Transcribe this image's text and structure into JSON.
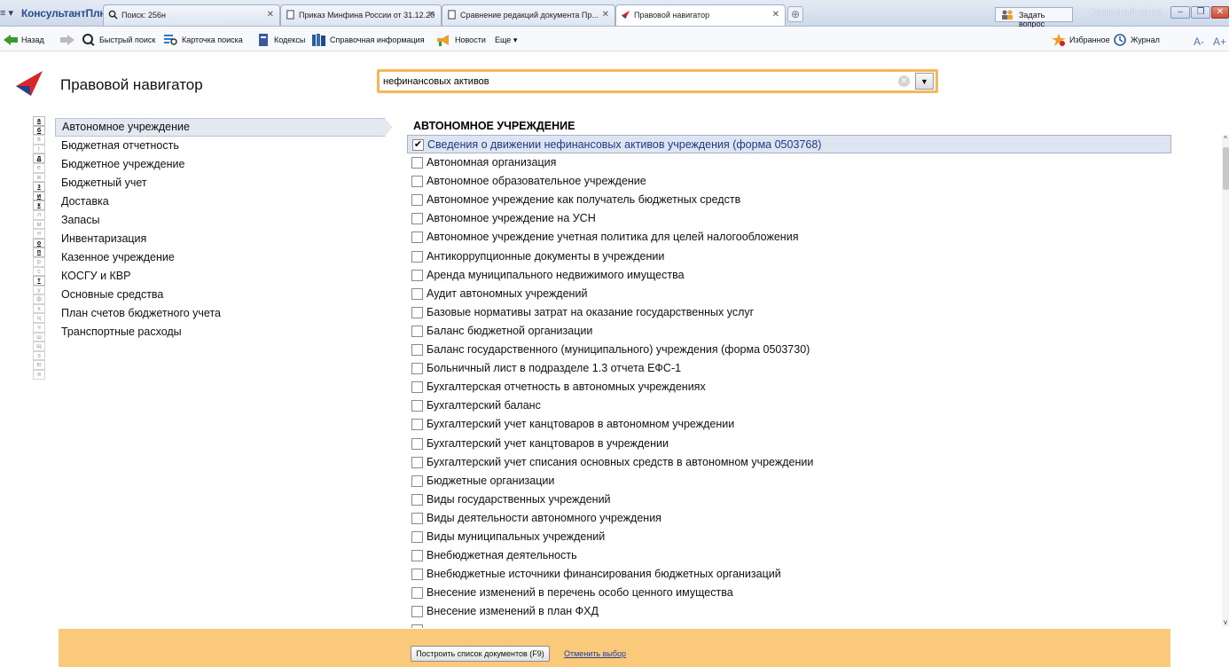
{
  "titlebar": {
    "app_menu": "≡ ▾",
    "brand": "КонсультантПлюс",
    "tabs": [
      {
        "label": "Поиск: 256н",
        "icon": "search-icon"
      },
      {
        "label": "Приказ Минфина России от 31.12.20",
        "icon": "document-icon"
      },
      {
        "label": "Сравнение редакций документа Пр...",
        "icon": "document-icon"
      },
      {
        "label": "Правовой навигатор",
        "icon": "navigator-logo-icon"
      }
    ],
    "ask_question": "Задать вопрос",
    "service_center": "Сервисный центр"
  },
  "toolbar": {
    "back": "Назад",
    "quick_search": "Быстрый поиск",
    "search_card": "Карточка поиска",
    "codes": "Кодексы",
    "reference": "Справочная информация",
    "news": "Новости",
    "more": "Еще ▾",
    "favorites": "Избранное",
    "journal": "Журнал",
    "font_smaller": "A-",
    "font_larger": "A+"
  },
  "header": {
    "title": "Правовой навигатор",
    "search_value": "нефинансовых активов"
  },
  "alphabet": [
    {
      "l": "а",
      "on": true
    },
    {
      "l": "б",
      "on": true
    },
    {
      "l": "в",
      "on": false
    },
    {
      "l": "г",
      "on": false
    },
    {
      "l": "д",
      "on": true
    },
    {
      "l": "е",
      "on": false
    },
    {
      "l": "ж",
      "on": false
    },
    {
      "l": "з",
      "on": true
    },
    {
      "l": "и",
      "on": true
    },
    {
      "l": "к",
      "on": true
    },
    {
      "l": "л",
      "on": false
    },
    {
      "l": "м",
      "on": false
    },
    {
      "l": "н",
      "on": false
    },
    {
      "l": "о",
      "on": true
    },
    {
      "l": "п",
      "on": true
    },
    {
      "l": "р",
      "on": false
    },
    {
      "l": "с",
      "on": false
    },
    {
      "l": "т",
      "on": true
    },
    {
      "l": "у",
      "on": false
    },
    {
      "l": "ф",
      "on": false
    },
    {
      "l": "х",
      "on": false
    },
    {
      "l": "ц",
      "on": false
    },
    {
      "l": "ч",
      "on": false
    },
    {
      "l": "ш",
      "on": false
    },
    {
      "l": "щ",
      "on": false
    },
    {
      "l": "э",
      "on": false
    },
    {
      "l": "ю",
      "on": false
    },
    {
      "l": "я",
      "on": false
    }
  ],
  "categories": [
    "Автономное учреждение",
    "Бюджетная отчетность",
    "Бюджетное учреждение",
    "Бюджетный учет",
    "Доставка",
    "Запасы",
    "Инвентаризация",
    "Казенное учреждение",
    "КОСГУ и КВР",
    "Основные средства",
    "План счетов бюджетного учета",
    "Транспортные расходы"
  ],
  "selected_category_index": 0,
  "section_title": "АВТОНОМНОЕ УЧРЕЖДЕНИЕ",
  "items": [
    {
      "label": "Сведения о движении нефинансовых активов учреждения (форма 0503768)",
      "checked": true
    },
    {
      "label": "Автономная организация",
      "checked": false
    },
    {
      "label": "Автономное образовательное учреждение",
      "checked": false
    },
    {
      "label": "Автономное учреждение как получатель бюджетных средств",
      "checked": false
    },
    {
      "label": "Автономное учреждение на УСН",
      "checked": false
    },
    {
      "label": "Автономное учреждение учетная политика для целей налогообложения",
      "checked": false
    },
    {
      "label": "Антикоррупционные документы в учреждении",
      "checked": false
    },
    {
      "label": "Аренда муниципального недвижимого имущества",
      "checked": false
    },
    {
      "label": "Аудит автономных учреждений",
      "checked": false
    },
    {
      "label": "Базовые нормативы затрат на оказание государственных услуг",
      "checked": false
    },
    {
      "label": "Баланс бюджетной организации",
      "checked": false
    },
    {
      "label": "Баланс государственного (муниципального) учреждения (форма 0503730)",
      "checked": false
    },
    {
      "label": "Больничный лист в подразделе 1.3 отчета ЕФС-1",
      "checked": false
    },
    {
      "label": "Бухгалтерская отчетность в автономных учреждениях",
      "checked": false
    },
    {
      "label": "Бухгалтерский баланс",
      "checked": false
    },
    {
      "label": "Бухгалтерский учет канцтоваров в автономном учреждении",
      "checked": false
    },
    {
      "label": "Бухгалтерский учет канцтоваров в учреждении",
      "checked": false
    },
    {
      "label": "Бухгалтерский учет списания основных средств в автономном учреждении",
      "checked": false
    },
    {
      "label": "Бюджетные организации",
      "checked": false
    },
    {
      "label": "Виды государственных учреждений",
      "checked": false
    },
    {
      "label": "Виды деятельности автономного учреждения",
      "checked": false
    },
    {
      "label": "Виды муниципальных учреждений",
      "checked": false
    },
    {
      "label": "Внебюджетная деятельность",
      "checked": false
    },
    {
      "label": "Внебюджетные источники финансирования бюджетных организаций",
      "checked": false
    },
    {
      "label": "Внесение изменений в перечень особо ценного имущества",
      "checked": false
    },
    {
      "label": "Внесение изменений в план ФХД",
      "checked": false
    },
    {
      "label": "",
      "checked": false
    }
  ],
  "bottom": {
    "build_button": "Построить список документов (F9)",
    "cancel_link": "Отменить выбор"
  },
  "colors": {
    "accent_orange": "#fac97a",
    "search_border": "#f5b75a",
    "selection_bg": "#dfe5f0",
    "link_blue": "#2140a8"
  }
}
